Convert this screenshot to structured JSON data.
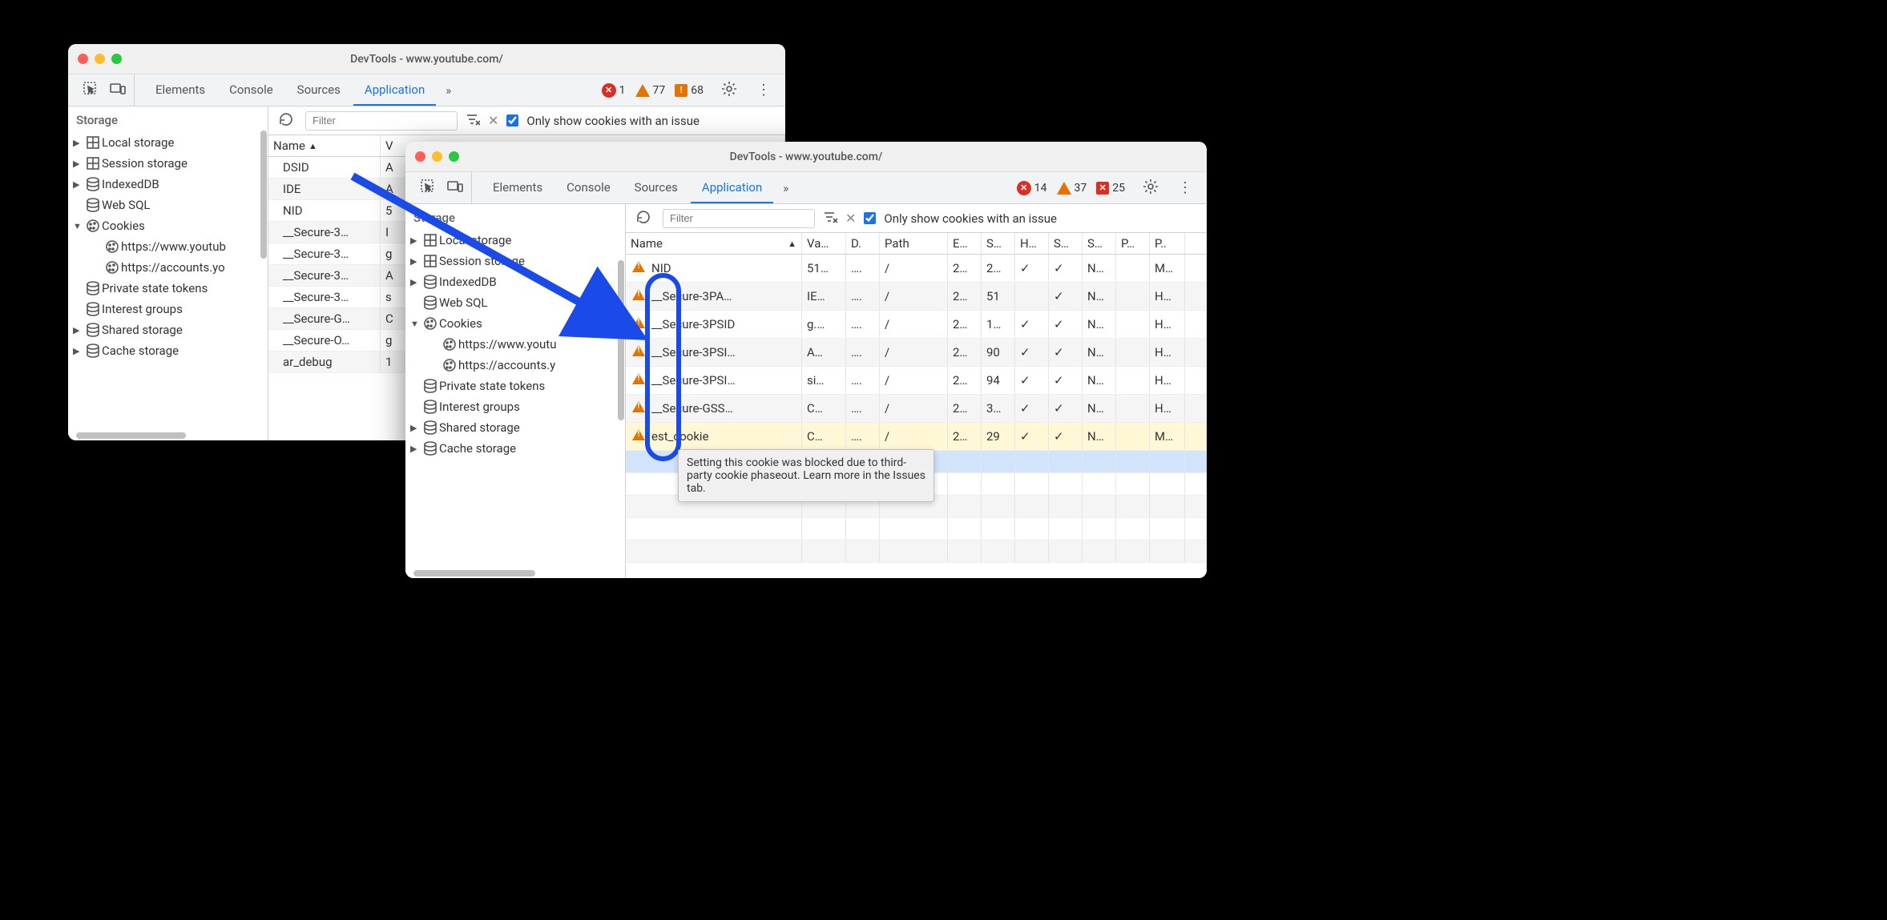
{
  "window1": {
    "title": "DevTools - www.youtube.com/",
    "tabs": [
      "Elements",
      "Console",
      "Sources",
      "Application"
    ],
    "active_tab": "Application",
    "issues": {
      "errors": "1",
      "warnings": "77",
      "info": "68"
    },
    "toolbar": {
      "filter_placeholder": "Filter",
      "only_issue_label": "Only show cookies with an issue"
    },
    "sidebar_heading": "Storage",
    "storage": {
      "local": "Local storage",
      "session": "Session storage",
      "indexed": "IndexedDB",
      "websql": "Web SQL",
      "cookies": "Cookies",
      "cookie_origins": [
        "https://www.youtub",
        "https://accounts.yo"
      ],
      "private": "Private state tokens",
      "interest": "Interest groups",
      "shared": "Shared storage",
      "cache": "Cache storage"
    },
    "cols": {
      "name": "Name",
      "val": "V"
    },
    "rows": [
      {
        "name": "DSID",
        "val": "A"
      },
      {
        "name": "IDE",
        "val": "A"
      },
      {
        "name": "NID",
        "val": "5"
      },
      {
        "name": "__Secure-3…",
        "val": "I"
      },
      {
        "name": "__Secure-3…",
        "val": "g"
      },
      {
        "name": "__Secure-3…",
        "val": "A"
      },
      {
        "name": "__Secure-3…",
        "val": "s"
      },
      {
        "name": "__Secure-G…",
        "val": "C"
      },
      {
        "name": "__Secure-O…",
        "val": "g"
      },
      {
        "name": "ar_debug",
        "val": "1"
      }
    ]
  },
  "window2": {
    "title": "DevTools - www.youtube.com/",
    "tabs": [
      "Elements",
      "Console",
      "Sources",
      "Application"
    ],
    "active_tab": "Application",
    "issues": {
      "errors": "14",
      "warnings": "37",
      "blocked": "25"
    },
    "toolbar": {
      "filter_placeholder": "Filter",
      "only_issue_label": "Only show cookies with an issue"
    },
    "sidebar_heading": "Storage",
    "storage": {
      "local": "Local storage",
      "session": "Session storage",
      "indexed": "IndexedDB",
      "websql": "Web SQL",
      "cookies": "Cookies",
      "cookie_origins": [
        "https://www.youtu",
        "https://accounts.y"
      ],
      "private": "Private state tokens",
      "interest": "Interest groups",
      "shared": "Shared storage",
      "cache": "Cache storage"
    },
    "cols": {
      "name": "Name",
      "val": "Va…",
      "d": "D.",
      "path": "Path",
      "e": "E…",
      "s": "S…",
      "h": "H…",
      "sec": "S…",
      "s2": "S…",
      "p": "P…",
      "plast": "P.."
    },
    "rows": [
      {
        "name": "NID",
        "val": "51…",
        "d": "….",
        "path": "/",
        "e": "2…",
        "s": "2…",
        "h": "✓",
        "sec": "✓",
        "s2": "N…",
        "p": "",
        "plast": "M…"
      },
      {
        "name": "__Secure-3PA…",
        "val": "IE…",
        "d": "….",
        "path": "/",
        "e": "2…",
        "s": "51",
        "h": "",
        "sec": "✓",
        "s2": "N…",
        "p": "",
        "plast": "H…"
      },
      {
        "name": "__Secure-3PSID",
        "val": "g.…",
        "d": "….",
        "path": "/",
        "e": "2…",
        "s": "1…",
        "h": "✓",
        "sec": "✓",
        "s2": "N…",
        "p": "",
        "plast": "H…"
      },
      {
        "name": "__Secure-3PSI…",
        "val": "A…",
        "d": "….",
        "path": "/",
        "e": "2…",
        "s": "90",
        "h": "✓",
        "sec": "✓",
        "s2": "N…",
        "p": "",
        "plast": "H…"
      },
      {
        "name": "__Secure-3PSI…",
        "val": "si…",
        "d": "….",
        "path": "/",
        "e": "2…",
        "s": "94",
        "h": "✓",
        "sec": "✓",
        "s2": "N…",
        "p": "",
        "plast": "H…"
      },
      {
        "name": "__Secure-GSS…",
        "val": "C…",
        "d": "….",
        "path": "/",
        "e": "2…",
        "s": "3…",
        "h": "✓",
        "sec": "✓",
        "s2": "N…",
        "p": "",
        "plast": "H…"
      },
      {
        "name": "est_cookie",
        "val": "C…",
        "d": "….",
        "path": "/",
        "e": "2…",
        "s": "29",
        "h": "✓",
        "sec": "✓",
        "s2": "N…",
        "p": "",
        "plast": "M…"
      }
    ],
    "tooltip": "Setting this cookie was blocked due to third-party cookie phaseout. Learn more in the Issues tab."
  }
}
